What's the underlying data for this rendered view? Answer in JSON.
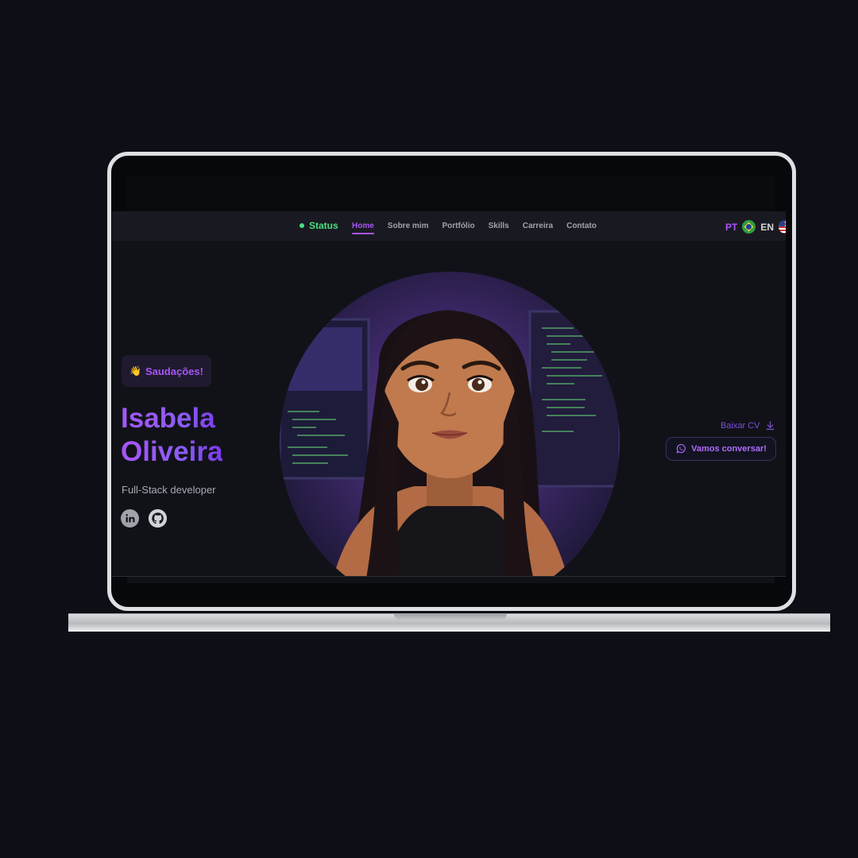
{
  "nav": {
    "status": "Status",
    "links": [
      "Home",
      "Sobre mim",
      "Portfólio",
      "Skills",
      "Carreira",
      "Contato"
    ],
    "active": "Home",
    "lang_pt": "PT",
    "lang_en": "EN"
  },
  "hero": {
    "greeting": "Saudações!",
    "greeting_icon": "waving-hand-icon",
    "name_line1": "Isabela",
    "name_line2": "Oliveira",
    "role": "Full-Stack developer",
    "social_icons": [
      "linkedin-icon",
      "github-icon"
    ],
    "download_cv": "Baixar CV",
    "cta": "Vamos conversar!",
    "cta_icon": "whatsapp-icon"
  },
  "colors": {
    "page_bg": "#0c0f16",
    "accent": "#a855f7",
    "status": "#4ade80",
    "nav_bg": "#191a21"
  }
}
